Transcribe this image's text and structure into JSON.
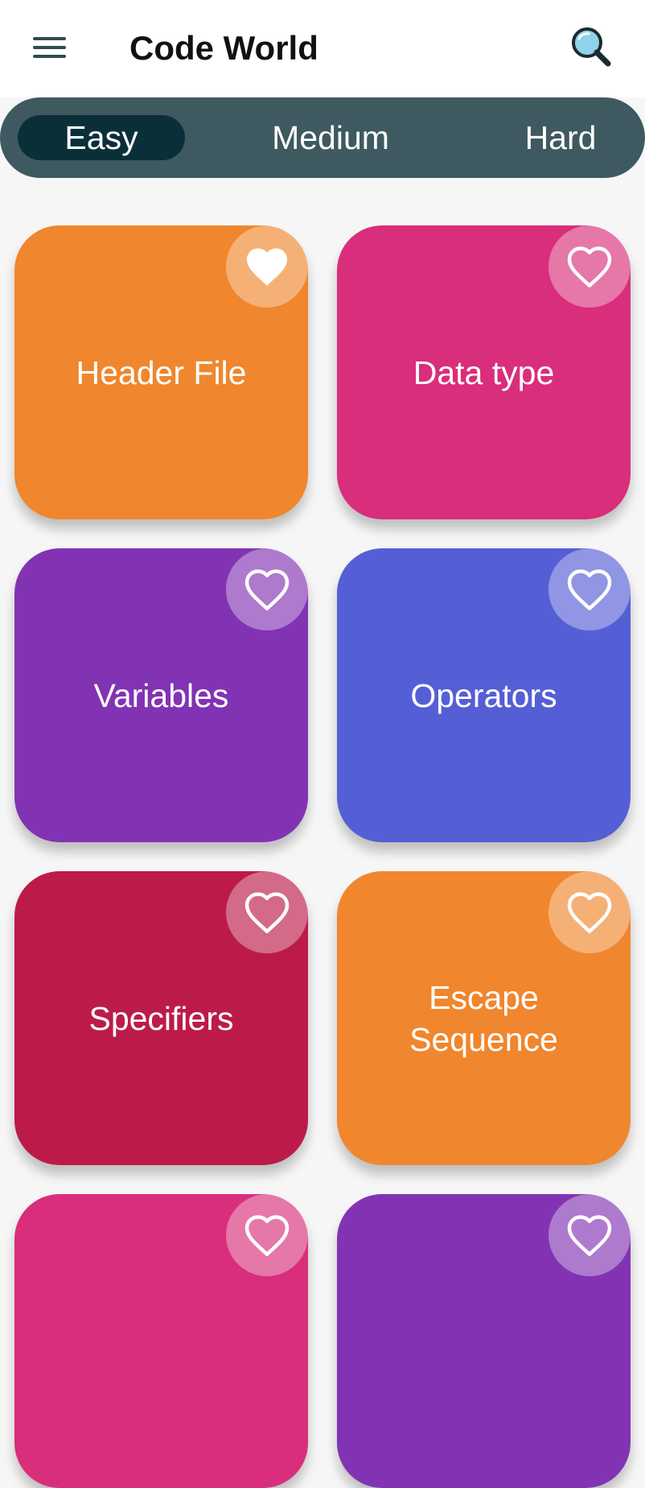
{
  "app": {
    "title": "Code World"
  },
  "toolbar": {
    "menu_icon": "hamburger-menu-icon",
    "search_icon": "magnifier-icon"
  },
  "tabs": [
    {
      "label": "Easy",
      "active": true
    },
    {
      "label": "Medium",
      "active": false
    },
    {
      "label": "Hard",
      "active": false
    }
  ],
  "cards": [
    {
      "title": "Header File",
      "color": "#f0862d",
      "favorite": true
    },
    {
      "title": "Data type",
      "color": "#d92e7b",
      "favorite": false
    },
    {
      "title": "Variables",
      "color": "#8233b3",
      "favorite": false
    },
    {
      "title": "Operators",
      "color": "#555fd5",
      "favorite": false
    },
    {
      "title": "Specifiers",
      "color": "#bc1b49",
      "favorite": false
    },
    {
      "title": "Escape Sequence",
      "color": "#f0862d",
      "favorite": false
    },
    {
      "title": "",
      "color": "#d92e7b",
      "favorite": false
    },
    {
      "title": "",
      "color": "#8233b3",
      "favorite": false
    }
  ],
  "colors": {
    "tab_bar": "#3f5960",
    "tab_active": "#0b2f38",
    "background": "#f6f6f6"
  }
}
